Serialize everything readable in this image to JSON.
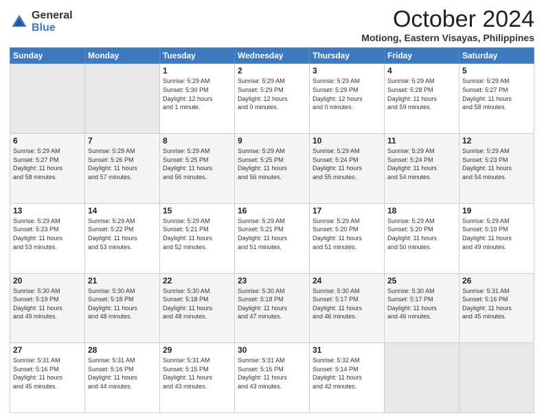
{
  "header": {
    "logo_line1": "General",
    "logo_line2": "Blue",
    "title": "October 2024",
    "subtitle": "Motiong, Eastern Visayas, Philippines"
  },
  "calendar": {
    "headers": [
      "Sunday",
      "Monday",
      "Tuesday",
      "Wednesday",
      "Thursday",
      "Friday",
      "Saturday"
    ],
    "weeks": [
      [
        {
          "day": "",
          "info": ""
        },
        {
          "day": "",
          "info": ""
        },
        {
          "day": "1",
          "info": "Sunrise: 5:29 AM\nSunset: 5:30 PM\nDaylight: 12 hours\nand 1 minute."
        },
        {
          "day": "2",
          "info": "Sunrise: 5:29 AM\nSunset: 5:29 PM\nDaylight: 12 hours\nand 0 minutes."
        },
        {
          "day": "3",
          "info": "Sunrise: 5:29 AM\nSunset: 5:29 PM\nDaylight: 12 hours\nand 0 minutes."
        },
        {
          "day": "4",
          "info": "Sunrise: 5:29 AM\nSunset: 5:28 PM\nDaylight: 11 hours\nand 59 minutes."
        },
        {
          "day": "5",
          "info": "Sunrise: 5:29 AM\nSunset: 5:27 PM\nDaylight: 11 hours\nand 58 minutes."
        }
      ],
      [
        {
          "day": "6",
          "info": "Sunrise: 5:29 AM\nSunset: 5:27 PM\nDaylight: 11 hours\nand 58 minutes."
        },
        {
          "day": "7",
          "info": "Sunrise: 5:29 AM\nSunset: 5:26 PM\nDaylight: 11 hours\nand 57 minutes."
        },
        {
          "day": "8",
          "info": "Sunrise: 5:29 AM\nSunset: 5:25 PM\nDaylight: 11 hours\nand 56 minutes."
        },
        {
          "day": "9",
          "info": "Sunrise: 5:29 AM\nSunset: 5:25 PM\nDaylight: 11 hours\nand 56 minutes."
        },
        {
          "day": "10",
          "info": "Sunrise: 5:29 AM\nSunset: 5:24 PM\nDaylight: 11 hours\nand 55 minutes."
        },
        {
          "day": "11",
          "info": "Sunrise: 5:29 AM\nSunset: 5:24 PM\nDaylight: 11 hours\nand 54 minutes."
        },
        {
          "day": "12",
          "info": "Sunrise: 5:29 AM\nSunset: 5:23 PM\nDaylight: 11 hours\nand 54 minutes."
        }
      ],
      [
        {
          "day": "13",
          "info": "Sunrise: 5:29 AM\nSunset: 5:23 PM\nDaylight: 11 hours\nand 53 minutes."
        },
        {
          "day": "14",
          "info": "Sunrise: 5:29 AM\nSunset: 5:22 PM\nDaylight: 11 hours\nand 53 minutes."
        },
        {
          "day": "15",
          "info": "Sunrise: 5:29 AM\nSunset: 5:21 PM\nDaylight: 11 hours\nand 52 minutes."
        },
        {
          "day": "16",
          "info": "Sunrise: 5:29 AM\nSunset: 5:21 PM\nDaylight: 11 hours\nand 51 minutes."
        },
        {
          "day": "17",
          "info": "Sunrise: 5:29 AM\nSunset: 5:20 PM\nDaylight: 11 hours\nand 51 minutes."
        },
        {
          "day": "18",
          "info": "Sunrise: 5:29 AM\nSunset: 5:20 PM\nDaylight: 11 hours\nand 50 minutes."
        },
        {
          "day": "19",
          "info": "Sunrise: 5:29 AM\nSunset: 5:19 PM\nDaylight: 11 hours\nand 49 minutes."
        }
      ],
      [
        {
          "day": "20",
          "info": "Sunrise: 5:30 AM\nSunset: 5:19 PM\nDaylight: 11 hours\nand 49 minutes."
        },
        {
          "day": "21",
          "info": "Sunrise: 5:30 AM\nSunset: 5:18 PM\nDaylight: 11 hours\nand 48 minutes."
        },
        {
          "day": "22",
          "info": "Sunrise: 5:30 AM\nSunset: 5:18 PM\nDaylight: 11 hours\nand 48 minutes."
        },
        {
          "day": "23",
          "info": "Sunrise: 5:30 AM\nSunset: 5:18 PM\nDaylight: 11 hours\nand 47 minutes."
        },
        {
          "day": "24",
          "info": "Sunrise: 5:30 AM\nSunset: 5:17 PM\nDaylight: 11 hours\nand 46 minutes."
        },
        {
          "day": "25",
          "info": "Sunrise: 5:30 AM\nSunset: 5:17 PM\nDaylight: 11 hours\nand 46 minutes."
        },
        {
          "day": "26",
          "info": "Sunrise: 5:31 AM\nSunset: 5:16 PM\nDaylight: 11 hours\nand 45 minutes."
        }
      ],
      [
        {
          "day": "27",
          "info": "Sunrise: 5:31 AM\nSunset: 5:16 PM\nDaylight: 11 hours\nand 45 minutes."
        },
        {
          "day": "28",
          "info": "Sunrise: 5:31 AM\nSunset: 5:16 PM\nDaylight: 11 hours\nand 44 minutes."
        },
        {
          "day": "29",
          "info": "Sunrise: 5:31 AM\nSunset: 5:15 PM\nDaylight: 11 hours\nand 43 minutes."
        },
        {
          "day": "30",
          "info": "Sunrise: 5:31 AM\nSunset: 5:15 PM\nDaylight: 11 hours\nand 43 minutes."
        },
        {
          "day": "31",
          "info": "Sunrise: 5:32 AM\nSunset: 5:14 PM\nDaylight: 11 hours\nand 42 minutes."
        },
        {
          "day": "",
          "info": ""
        },
        {
          "day": "",
          "info": ""
        }
      ]
    ]
  }
}
